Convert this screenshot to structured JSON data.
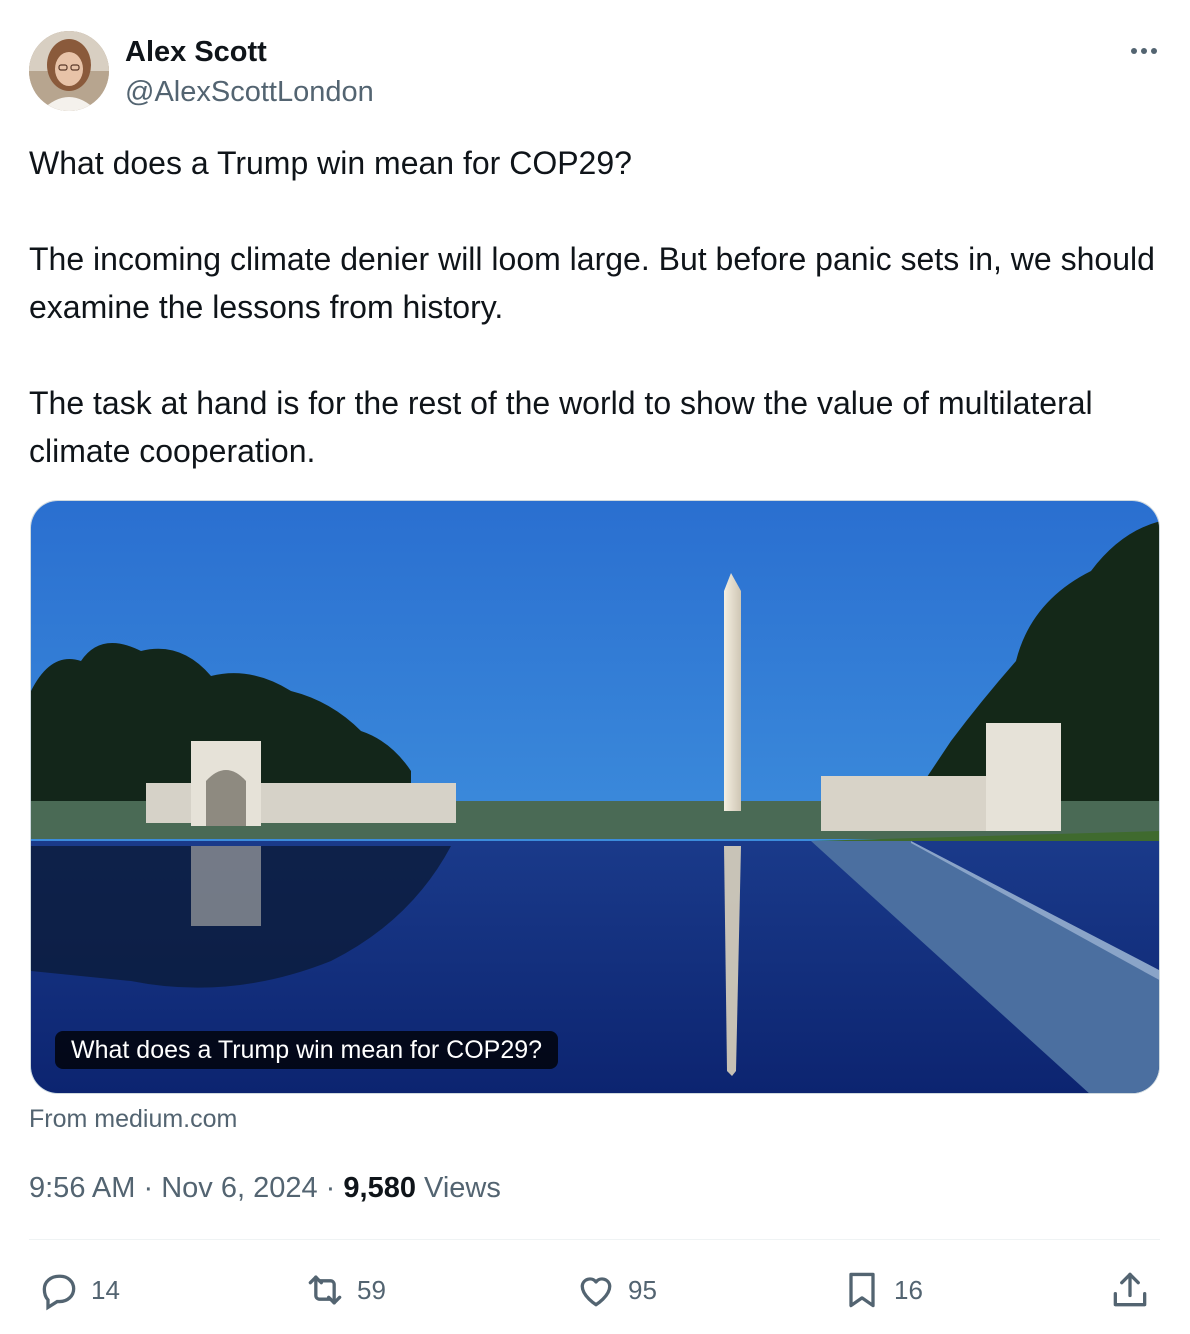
{
  "author": {
    "name": "Alex Scott",
    "handle": "@AlexScottLondon"
  },
  "tweet": {
    "paragraphs": [
      "What does a Trump win mean for COP29?",
      "The incoming climate denier will loom large. But before panic sets in, we should examine the lessons from history.",
      "The task at hand is for the rest of the world to show the value of multilateral climate cooperation."
    ]
  },
  "card": {
    "caption": "What does a Trump win mean for COP29?",
    "source": "From medium.com"
  },
  "meta": {
    "time": "9:56 AM",
    "separator": "·",
    "date": "Nov 6, 2024",
    "views_count": "9,580",
    "views_label": "Views"
  },
  "actions": {
    "replies": "14",
    "reposts": "59",
    "likes": "95",
    "bookmarks": "16"
  },
  "icons": {
    "more": "more-horizontal-icon",
    "reply": "speech-bubble-icon",
    "repost": "repost-arrows-icon",
    "like": "heart-icon",
    "bookmark": "bookmark-icon",
    "share": "share-upload-icon"
  },
  "colors": {
    "text_primary": "#0f1419",
    "text_secondary": "#536471",
    "divider": "#eff3f4"
  }
}
